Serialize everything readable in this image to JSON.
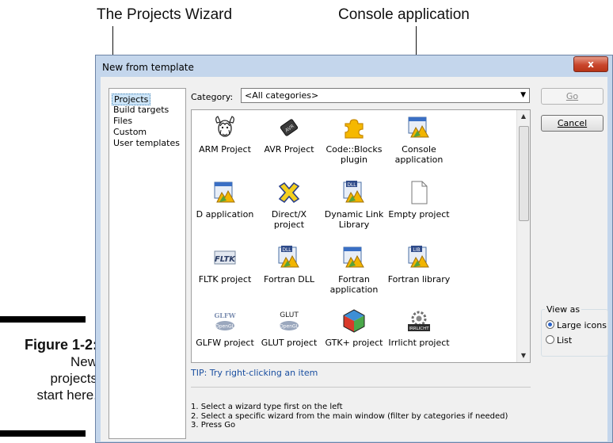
{
  "callouts": {
    "wizard": "The Projects Wizard",
    "console": "Console application"
  },
  "figure": {
    "number": "Figure 1-2:",
    "caption_lines": [
      "New",
      "projects",
      "start here."
    ]
  },
  "window": {
    "title": "New from template",
    "close_glyph": "x"
  },
  "sidebar": {
    "items": [
      {
        "label": "Projects",
        "selected": true
      },
      {
        "label": "Build targets"
      },
      {
        "label": "Files"
      },
      {
        "label": "Custom"
      },
      {
        "label": "User templates"
      }
    ]
  },
  "category": {
    "label": "Category:",
    "value": "<All categories>"
  },
  "templates": [
    {
      "label": "ARM Project",
      "icon": "gnu-icon"
    },
    {
      "label": "AVR Project",
      "icon": "avr-chip-icon"
    },
    {
      "label": "Code::Blocks plugin",
      "icon": "puzzle-icon"
    },
    {
      "label": "Console application",
      "icon": "console-app-icon"
    },
    {
      "label": "D application",
      "icon": "app-icon"
    },
    {
      "label": "Direct/X project",
      "icon": "directx-icon"
    },
    {
      "label": "Dynamic Link Library",
      "icon": "dll-icon"
    },
    {
      "label": "Empty project",
      "icon": "blank-page-icon"
    },
    {
      "label": "FLTK project",
      "icon": "fltk-icon"
    },
    {
      "label": "Fortran DLL",
      "icon": "dll-icon"
    },
    {
      "label": "Fortran application",
      "icon": "app-icon"
    },
    {
      "label": "Fortran library",
      "icon": "lib-icon"
    },
    {
      "label": "GLFW project",
      "icon": "glfw-icon"
    },
    {
      "label": "GLUT project",
      "icon": "glut-icon"
    },
    {
      "label": "GTK+ project",
      "icon": "gtk-cube-icon"
    },
    {
      "label": "Irrlicht project",
      "icon": "irrlicht-icon"
    }
  ],
  "icon_text": {
    "avr": "AVR",
    "dll": "DLL",
    "lib": "LIB",
    "fltk": "FLTK",
    "glfw": "GLFW",
    "glut": "GLUT",
    "opengl": "OpenGL",
    "irrlicht": "IRRLICHT"
  },
  "tip": "TIP: Try right-clicking an item",
  "instructions": [
    "1. Select a wizard type first on the left",
    "2. Select a specific wizard from the main window (filter by categories if needed)",
    "3. Press Go"
  ],
  "buttons": {
    "go": {
      "label": "Go",
      "enabled": false
    },
    "cancel": {
      "label": "Cancel"
    }
  },
  "view_as": {
    "legend": "View as",
    "options": [
      {
        "label": "Large icons",
        "checked": true
      },
      {
        "label": "List",
        "checked": false
      }
    ]
  },
  "colors": {
    "selection": "#cce4f7",
    "tip_text": "#1a4fa0",
    "close_button": "#c9462c"
  }
}
